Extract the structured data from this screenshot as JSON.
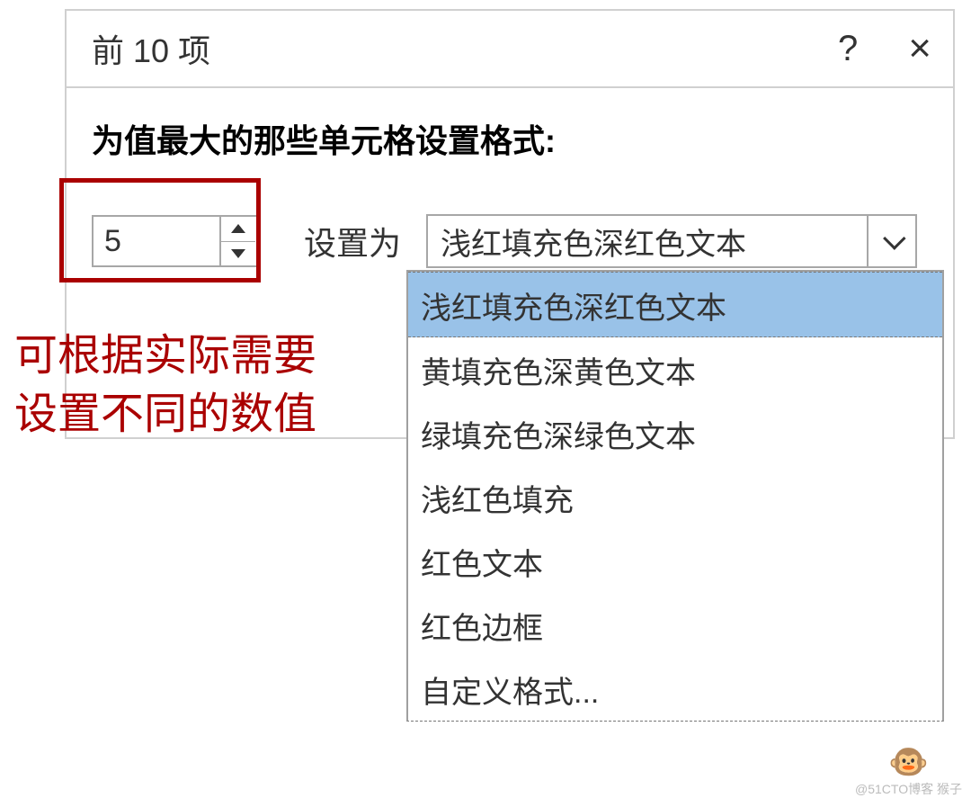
{
  "dialog": {
    "title": "前 10 项",
    "help_symbol": "?",
    "close_symbol": "×",
    "instruction": "为值最大的那些单元格设置格式:",
    "count_value": "5",
    "set_label": "设置为",
    "format_selected": "浅红填充色深红色文本",
    "format_options": [
      "浅红填充色深红色文本",
      "黄填充色深黄色文本",
      "绿填充色深绿色文本",
      "浅红色填充",
      "红色文本",
      "红色边框",
      "自定义格式..."
    ]
  },
  "annotation": {
    "line1": "可根据实际需要",
    "line2": "设置不同的数值"
  },
  "watermark": {
    "icon": "🐵",
    "text": "@51CTO博客  猴子"
  }
}
